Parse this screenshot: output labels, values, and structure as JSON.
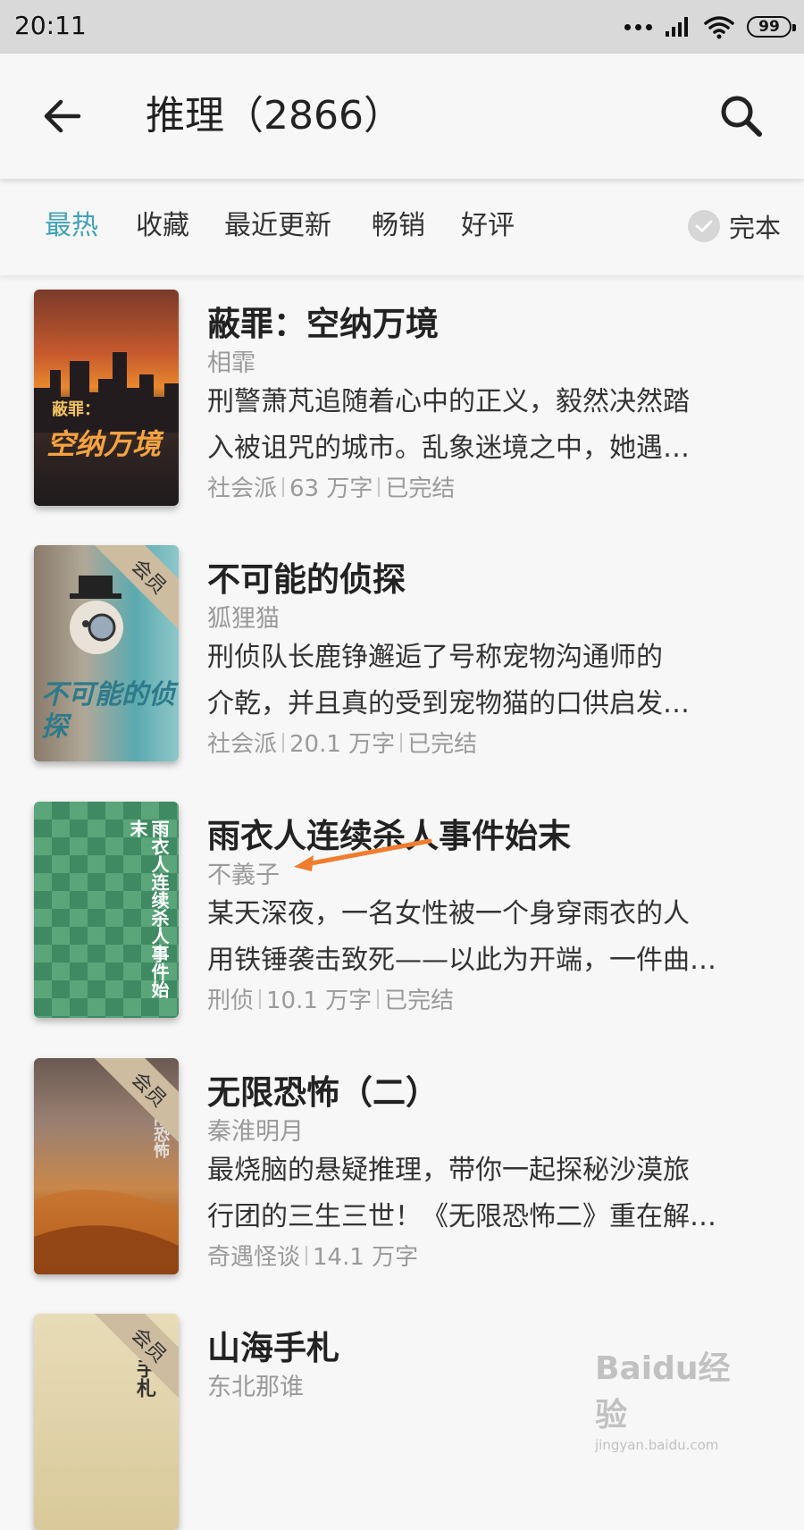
{
  "status_bar": {
    "time": "20:11",
    "battery": "99"
  },
  "header": {
    "title": "推理（2866）"
  },
  "tabs": [
    {
      "label": "最热",
      "active": true
    },
    {
      "label": "收藏",
      "active": false
    },
    {
      "label": "最近更新",
      "active": false
    },
    {
      "label": "畅销",
      "active": false
    },
    {
      "label": "好评",
      "active": false
    }
  ],
  "filter": {
    "label": "完本"
  },
  "books": [
    {
      "title": "蔽罪：空纳万境",
      "author": "相霏",
      "desc_line1": "刑警萧芃追随着心中的正义，毅然决然踏",
      "desc_line2": "入被诅咒的城市。乱象迷境之中，她遇…",
      "genre": "社会派",
      "words": "63 万字",
      "status": "已完结",
      "cover_title": "空纳万境",
      "cover_sub": "蔽罪：",
      "vip": false
    },
    {
      "title": "不可能的侦探",
      "author": "狐狸猫",
      "desc_line1": "刑侦队长鹿铮邂逅了号称宠物沟通师的",
      "desc_line2": "介乾，并且真的受到宠物猫的口供启发…",
      "genre": "社会派",
      "words": "20.1 万字",
      "status": "已完结",
      "cover_title": "不可能的侦探",
      "vip": true
    },
    {
      "title": "雨衣人连续杀人事件始末",
      "author": "不義子",
      "desc_line1": "某天深夜，一名女性被一个身穿雨衣的人",
      "desc_line2": "用铁锤袭击致死——以此为开端，一件曲…",
      "genre": "刑侦",
      "words": "10.1 万字",
      "status": "已完结",
      "cover_title": "雨衣人连续杀人事件始末",
      "vip": false
    },
    {
      "title": "无限恐怖（二）",
      "author": "秦淮明月",
      "desc_line1": "最烧脑的悬疑推理，带你一起探秘沙漠旅",
      "desc_line2": "行团的三生三世！《无限恐怖二》重在解…",
      "genre": "奇遇怪谈",
      "words": "14.1 万字",
      "status": "",
      "cover_title": "无限恐怖",
      "vip": true
    },
    {
      "title": "山海手札",
      "author": "东北那谁",
      "cover_title": "手札",
      "vip": true
    }
  ],
  "vip_label": "会员",
  "watermark": {
    "top": "Baidu经验",
    "bottom": "jingyan.baidu.com"
  },
  "colors": {
    "accent": "#3fa1b8",
    "statusbar": "#d9d9d9",
    "background": "#f7f7f7",
    "annotation_arrow": "#f07c2e"
  }
}
